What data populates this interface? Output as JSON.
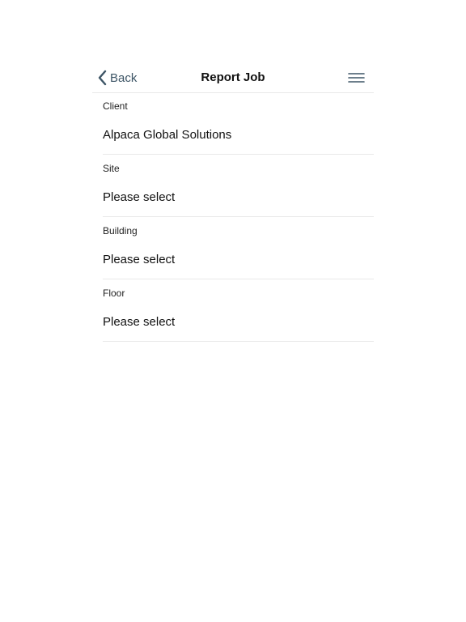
{
  "nav": {
    "back_label": "Back",
    "title": "Report Job",
    "back_icon": "chevron-left-icon",
    "menu_icon": "hamburger-menu-icon",
    "accent_color": "#3d5566"
  },
  "form": {
    "fields": [
      {
        "label": "Client",
        "value": "Alpaca Global Solutions"
      },
      {
        "label": "Site",
        "value": "Please select"
      },
      {
        "label": "Building",
        "value": "Please select"
      },
      {
        "label": "Floor",
        "value": "Please select"
      }
    ]
  }
}
